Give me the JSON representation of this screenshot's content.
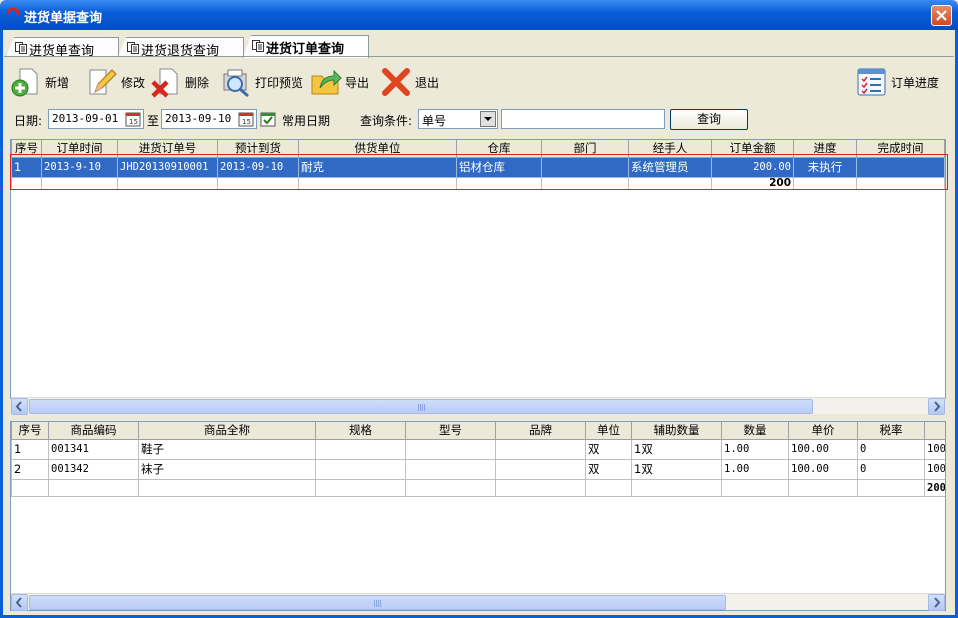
{
  "window": {
    "title": "进货单据查询"
  },
  "tabs": [
    {
      "label": "进货单查询"
    },
    {
      "label": "进货退货查询"
    },
    {
      "label": "进货订单查询"
    }
  ],
  "toolbar": {
    "new_label": "新增",
    "edit_label": "修改",
    "delete_label": "删除",
    "print_label": "打印预览",
    "export_label": "导出",
    "exit_label": "退出",
    "progress_label": "订单进度"
  },
  "filter": {
    "date_label": "日期:",
    "date_from": "2013-09-01",
    "to_label": "至",
    "date_to": "2013-09-10",
    "common_dates_label": "常用日期",
    "condition_label": "查询条件:",
    "condition_value": "单号",
    "condition_input": "",
    "query_button": "查询"
  },
  "orders": {
    "columns": [
      "序号",
      "订单时间",
      "进货订单号",
      "预计到货",
      "供货单位",
      "仓库",
      "部门",
      "经手人",
      "订单金额",
      "进度",
      "完成时间"
    ],
    "rows": [
      [
        "1",
        "2013-9-10",
        "JHD20130910001",
        "2013-09-10",
        "耐克",
        "铝材仓库",
        "",
        "系统管理员",
        "200.00",
        "未执行",
        ""
      ]
    ],
    "total_amount": "200"
  },
  "details": {
    "columns": [
      "序号",
      "商品编码",
      "商品全称",
      "规格",
      "型号",
      "品牌",
      "单位",
      "辅助数量",
      "数量",
      "单价",
      "税率"
    ],
    "rows": [
      [
        "1",
        "001341",
        "鞋子",
        "",
        "",
        "",
        "双",
        "1双",
        "1.00",
        "100.00",
        "0",
        "100"
      ],
      [
        "2",
        "001342",
        "袜子",
        "",
        "",
        "",
        "双",
        "1双",
        "1.00",
        "100.00",
        "0",
        "100"
      ]
    ],
    "total": "200"
  }
}
